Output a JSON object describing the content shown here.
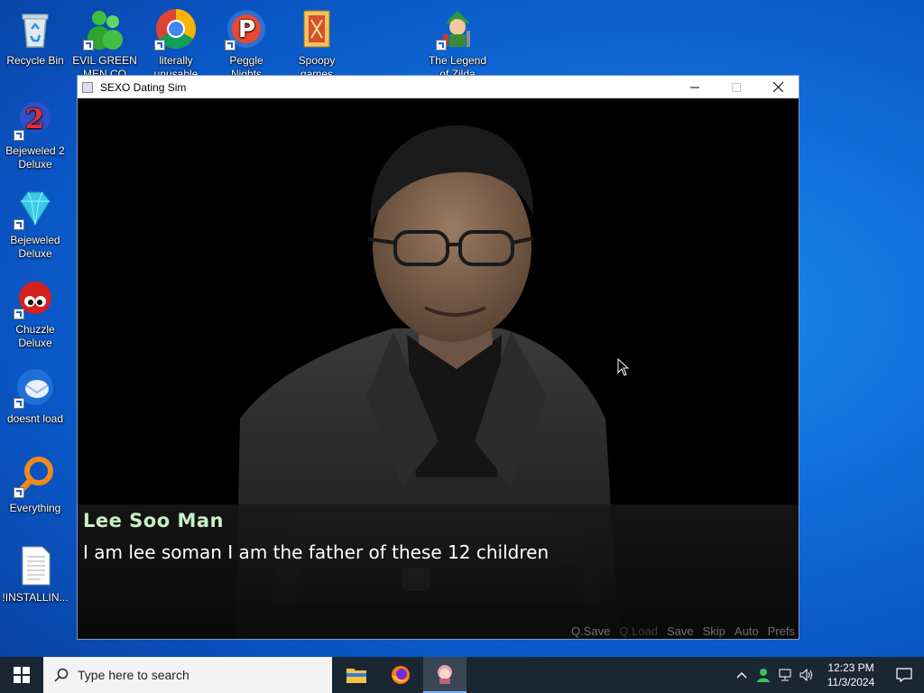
{
  "desktop": {
    "icons": [
      {
        "label": "Recycle Bin"
      },
      {
        "label": "EVIL GREEN MEN CO"
      },
      {
        "label": "literally unusable"
      },
      {
        "label": "Peggle Nights Deluxe"
      },
      {
        "label": "Spoopy games"
      },
      {
        "label": "The Legend of Zilda"
      },
      {
        "label": "Bejeweled 2 Deluxe"
      },
      {
        "label": "Bejeweled Deluxe"
      },
      {
        "label": "Chuzzle Deluxe"
      },
      {
        "label": "doesnt load"
      },
      {
        "label": "Everything"
      },
      {
        "label": "!INSTALLIN..."
      }
    ]
  },
  "window": {
    "title": "SEXO Dating Sim"
  },
  "game": {
    "speaker": "Lee Soo Man",
    "dialogue": "I am lee soman I am the father of these 12 children",
    "quickmenu": [
      {
        "label": "Q.Save",
        "enabled": true
      },
      {
        "label": "Q.Load",
        "enabled": false
      },
      {
        "label": "Save",
        "enabled": true
      },
      {
        "label": "Skip",
        "enabled": true
      },
      {
        "label": "Auto",
        "enabled": true
      },
      {
        "label": "Prefs",
        "enabled": true
      }
    ]
  },
  "taskbar": {
    "search_placeholder": "Type here to search",
    "time": "12:23 PM",
    "date": "11/3/2024"
  }
}
